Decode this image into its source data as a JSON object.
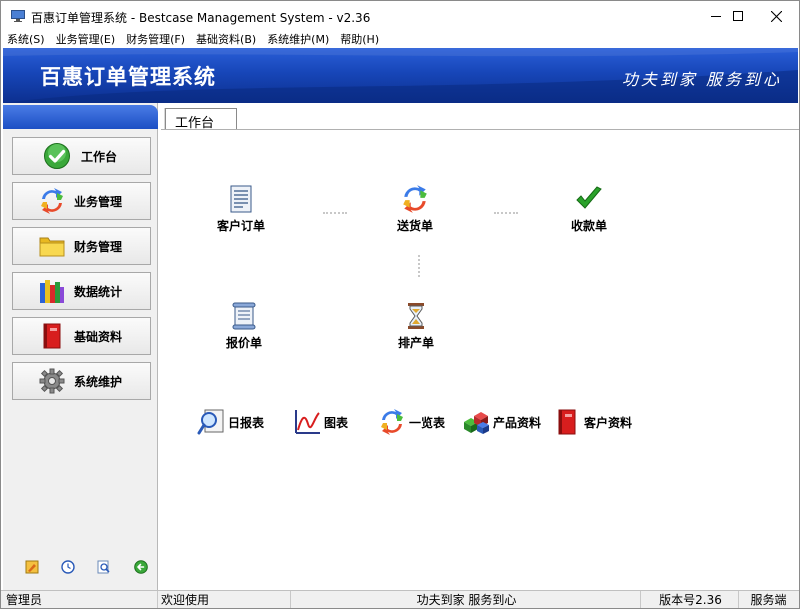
{
  "window": {
    "title": "百惠订单管理系统 - Bestcase Management System - v2.36"
  },
  "menu": [
    {
      "label": "系统(S)"
    },
    {
      "label": "业务管理(E)"
    },
    {
      "label": "财务管理(F)"
    },
    {
      "label": "基础资料(B)"
    },
    {
      "label": "系统维护(M)"
    },
    {
      "label": "帮助(H)"
    }
  ],
  "banner": {
    "title": "百惠订单管理系统",
    "slogan": "功夫到家 服务到心"
  },
  "sidebar": {
    "items": [
      {
        "label": "工作台",
        "icon": "check-icon"
      },
      {
        "label": "业务管理",
        "icon": "cycle-arrows-icon"
      },
      {
        "label": "财务管理",
        "icon": "folder-icon"
      },
      {
        "label": "数据统计",
        "icon": "books-icon"
      },
      {
        "label": "基础资料",
        "icon": "red-book-icon"
      },
      {
        "label": "系统维护",
        "icon": "gear-icon"
      }
    ],
    "footer_icons": [
      "pencil-icon",
      "clock-icon",
      "preview-icon",
      "back-arrow-icon"
    ]
  },
  "tab": {
    "label": "工作台"
  },
  "workflow": {
    "customer_order": "客户订单",
    "delivery_note": "送货单",
    "receipt": "收款单",
    "quotation": "报价单",
    "production": "排产单"
  },
  "quick_links": {
    "daily_report": "日报表",
    "chart": "图表",
    "overview": "一览表",
    "product_info": "产品资料",
    "customer_info": "客户资料"
  },
  "statusbar": {
    "user": "管理员",
    "welcome": "欢迎使用",
    "slogan": "功夫到家 服务到心",
    "version": "版本号2.36",
    "mode": "服务端"
  },
  "colors": {
    "banner_blue": "#1746b8",
    "sidebar_bg": "#f0f0f0"
  }
}
